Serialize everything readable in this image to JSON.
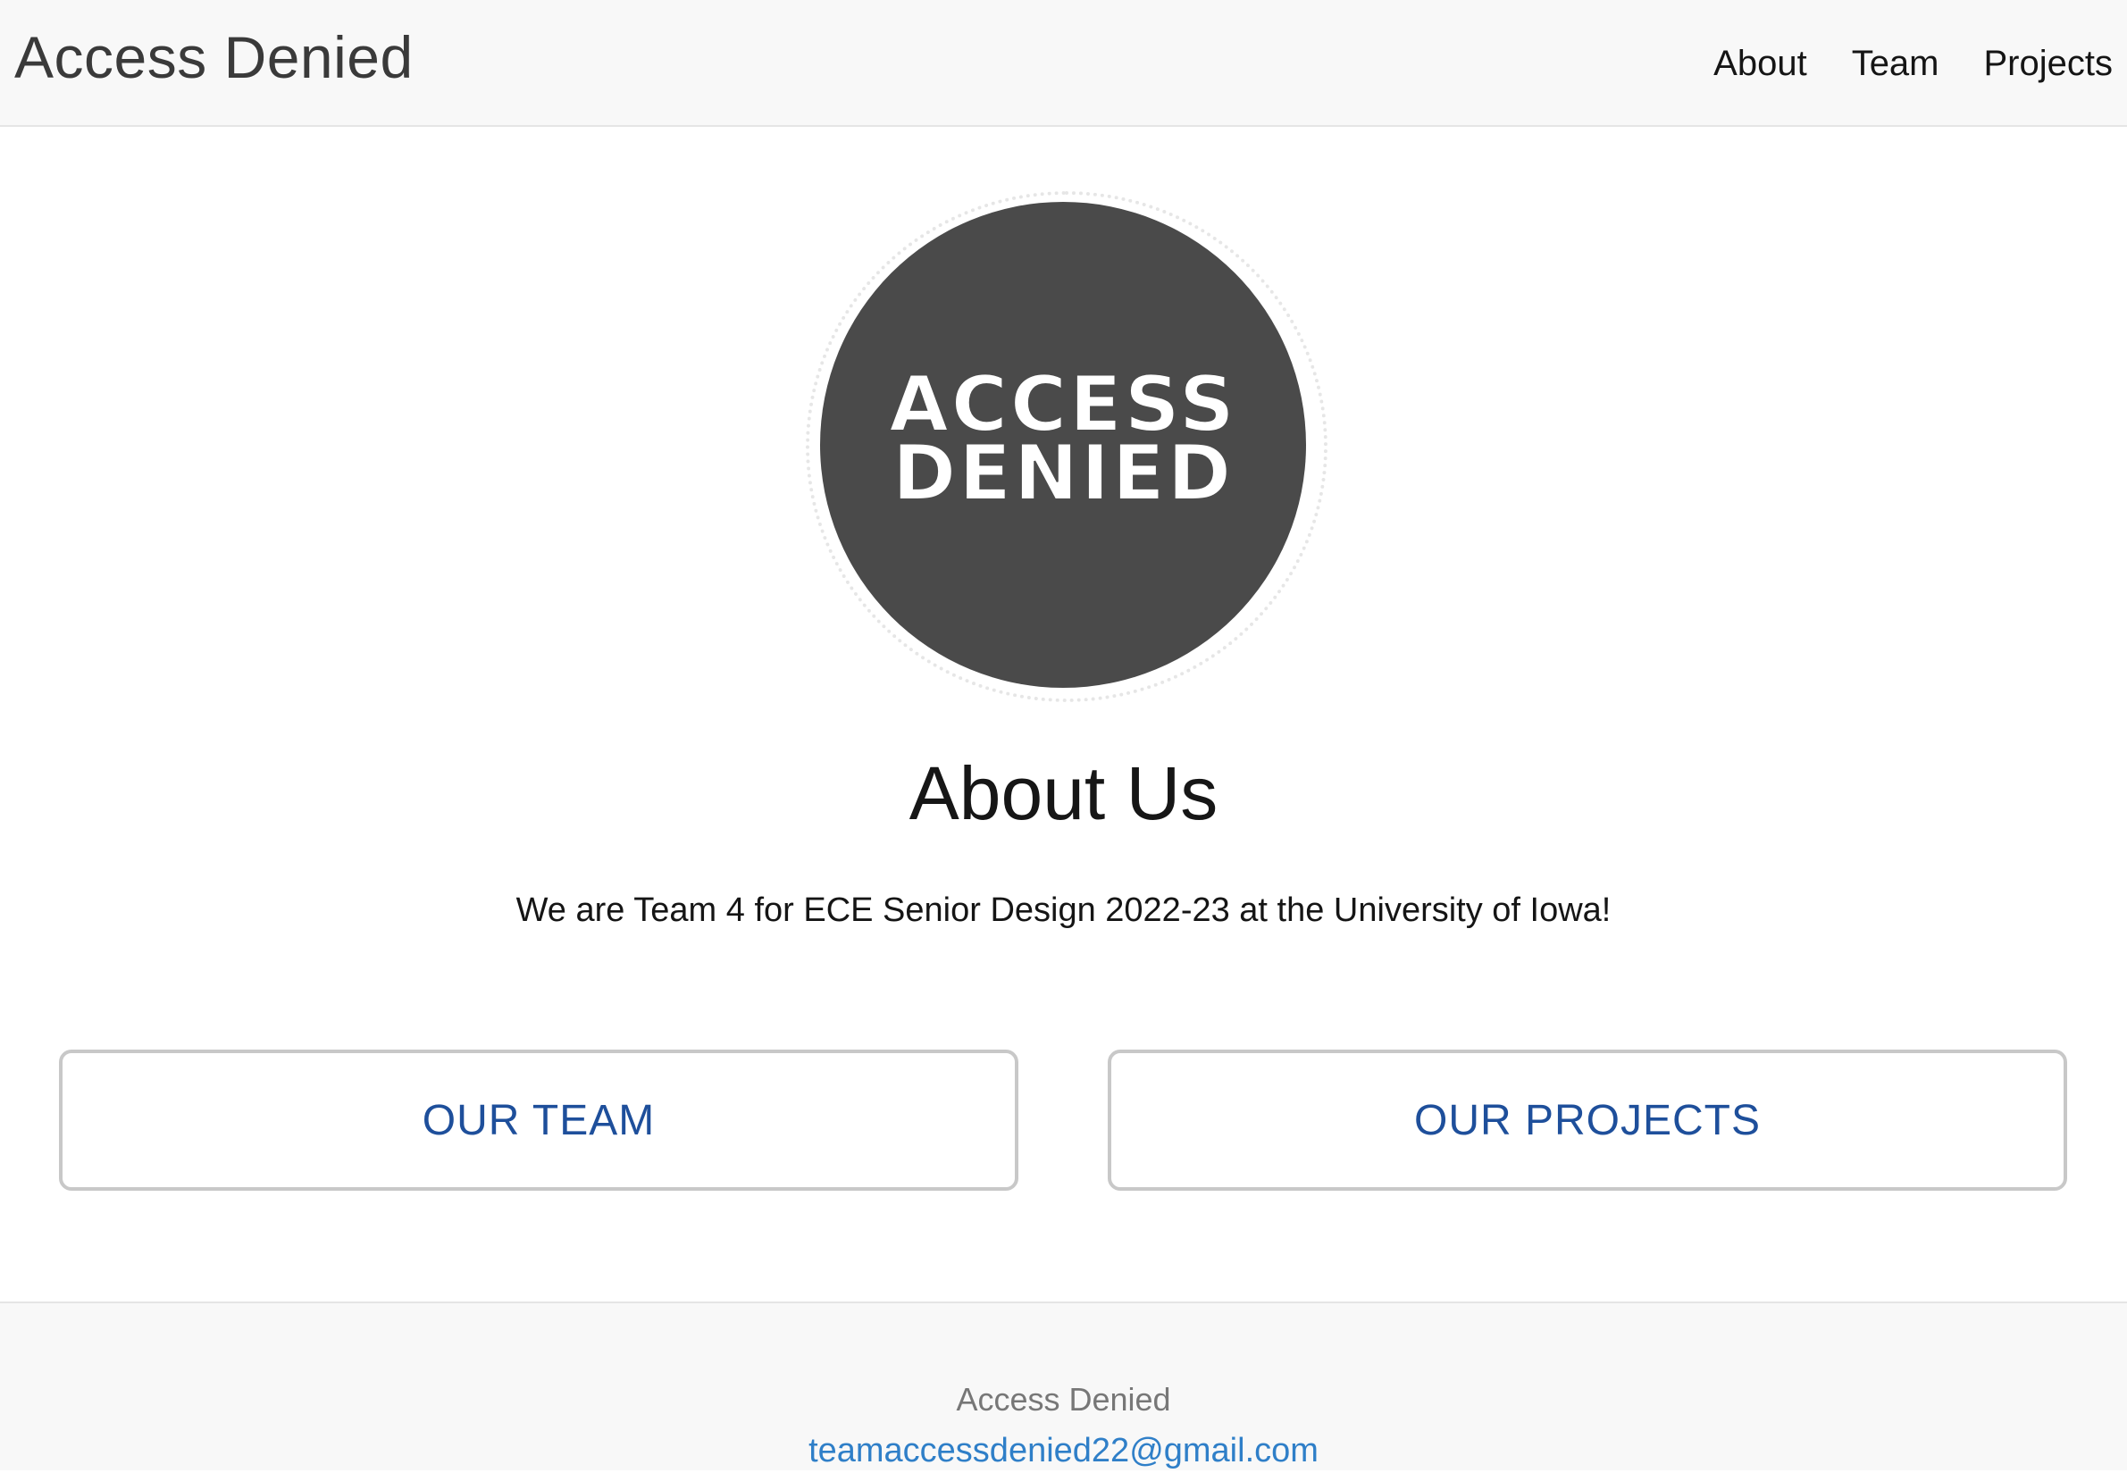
{
  "navbar": {
    "brand": "Access Denied",
    "links": [
      {
        "label": "About"
      },
      {
        "label": "Team"
      },
      {
        "label": "Projects"
      }
    ]
  },
  "logo": {
    "line1": "ACCESS",
    "line2": "DENIED"
  },
  "about": {
    "title": "About Us",
    "description": "We are Team 4 for ECE Senior Design 2022-23 at the University of Iowa!"
  },
  "buttons": {
    "team": "OUR TEAM",
    "projects": "OUR PROJECTS"
  },
  "footer": {
    "name": "Access Denied",
    "email": "teamaccessdenied22@gmail.com"
  },
  "colors": {
    "button_text": "#1e4f9b",
    "link": "#2f7fc8",
    "logo_bg": "#4a4a4a"
  }
}
